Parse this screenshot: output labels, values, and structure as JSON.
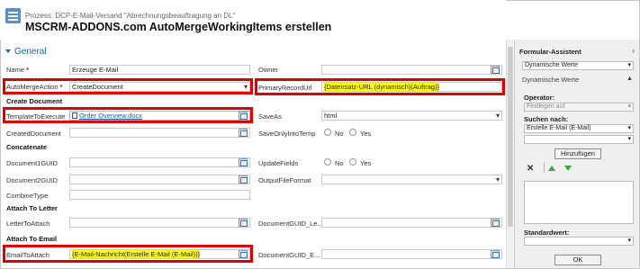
{
  "header": {
    "process_label": "Prozess: DCP-E-Mail-Versand \"Abrechnungsbeauftragung an DL\"",
    "title": "MSCRM-ADDONS.com AutoMergeWorkingItems erstellen"
  },
  "section": {
    "title": "General"
  },
  "groups": {
    "create_document": "Create Document",
    "concatenate": "Concatenate",
    "attach_to_letter": "Attach To Letter",
    "attach_to_email": "Attach To Email"
  },
  "fields": {
    "name": {
      "label": "Name",
      "required": "*",
      "value": "Erzeuge E-Mail"
    },
    "auto_merge_action": {
      "label": "AutoMergeAction",
      "required": "*",
      "value": "CreateDocument"
    },
    "template_to_execute": {
      "label": "TemplateToExecute",
      "value": "Order Overview.docx"
    },
    "created_document": {
      "label": "CreatedDocument",
      "value": ""
    },
    "document1_guid": {
      "label": "Document1GUID",
      "value": ""
    },
    "document2_guid": {
      "label": "Document2GUID",
      "value": ""
    },
    "combine_type": {
      "label": "CombineType",
      "value": ""
    },
    "letter_to_attach": {
      "label": "LetterToAttach",
      "value": ""
    },
    "email_to_attach": {
      "label": "EmailToAttach",
      "value": "{E-Mail-Nachricht(Erstelle E-Mail (E-Mail))}"
    },
    "owner": {
      "label": "Owner",
      "value": ""
    },
    "primary_record_url": {
      "label": "PrimaryRecordUrl",
      "value": "{Datensatz-URL (dynamisch)(Auftrag)}"
    },
    "save_as": {
      "label": "SaveAs",
      "value": "html"
    },
    "save_only_into_temp": {
      "label": "SaveOnlyIntoTemp",
      "no": "No",
      "yes": "Yes"
    },
    "update_fields": {
      "label": "UpdateFields",
      "no": "No",
      "yes": "Yes"
    },
    "output_file_format": {
      "label": "OutputFileFormat",
      "value": ""
    },
    "document_guid_le": {
      "label": "DocumentGUID_Le...",
      "value": ""
    },
    "document_guid_e": {
      "label": "DocumentGUID_E...",
      "value": ""
    }
  },
  "panel": {
    "title": "Formular-Assistent",
    "dynamic_values_select": "Dynamische Werte",
    "dynamic_values_header": "Dynamische Werte",
    "operator_label": "Operator:",
    "operator_value": "Festlegen auf",
    "search_label": "Suchen nach:",
    "search_value": "Erstelle E-Mail (E-Mail)",
    "search_value2": "",
    "add_button": "Hinzufügen",
    "default_label": "Standardwert:",
    "default_value": "",
    "ok_button": "OK"
  },
  "colors": {
    "accent": "#1160b7",
    "highlight_box": "#e00000",
    "highlight_text": "#ffff00"
  }
}
